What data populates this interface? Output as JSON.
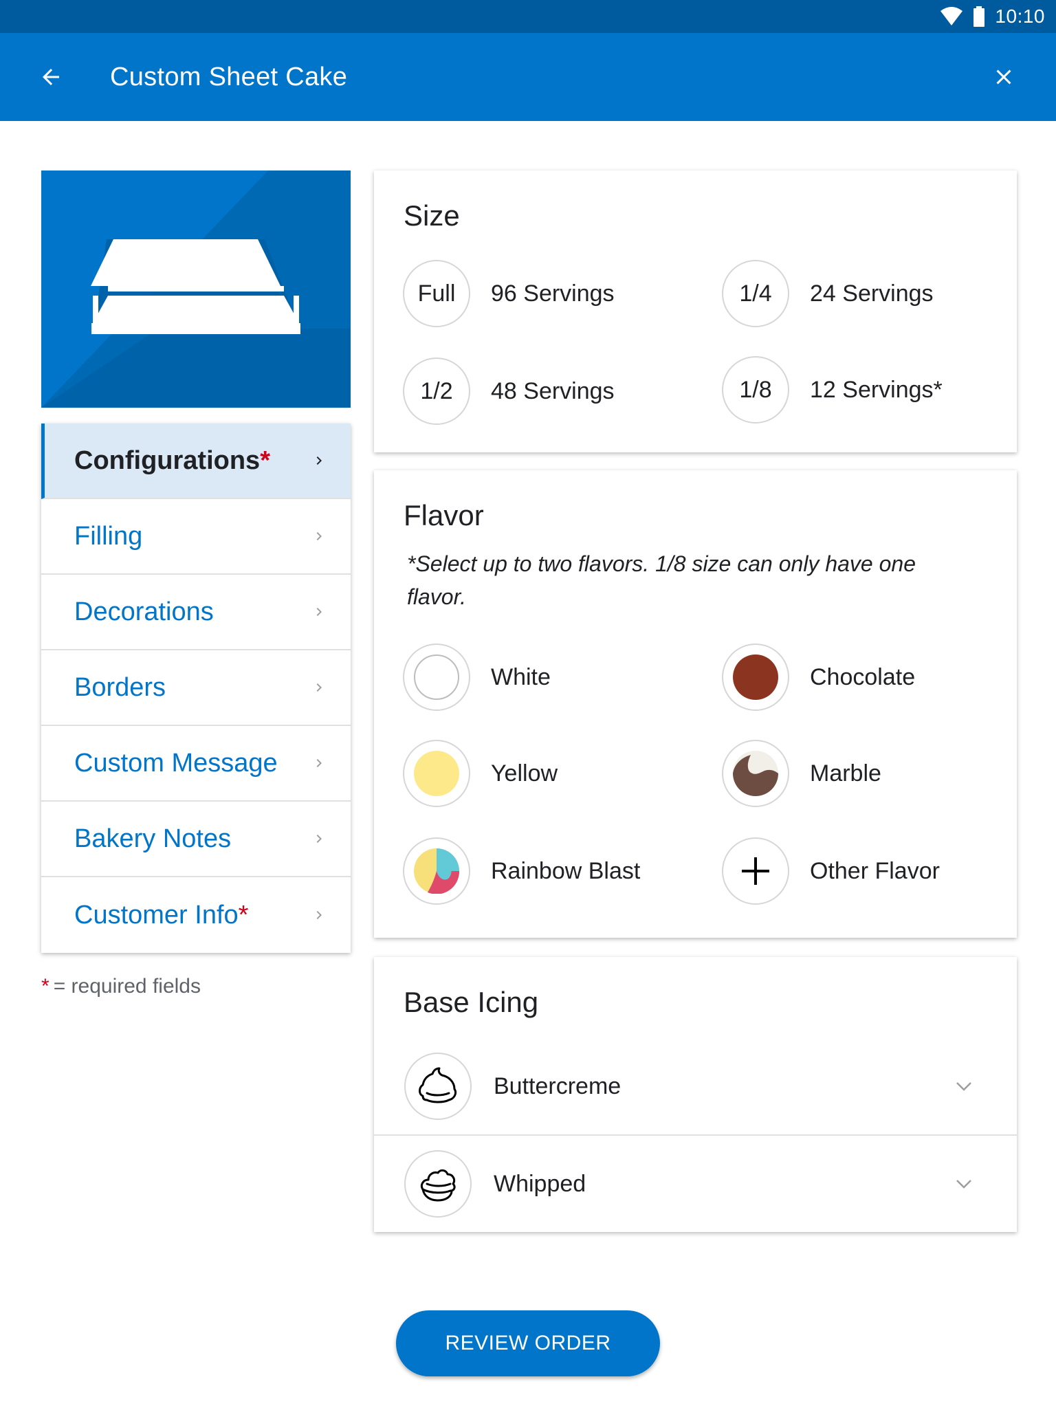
{
  "status_bar": {
    "time": "10:10"
  },
  "app_bar": {
    "title": "Custom Sheet Cake"
  },
  "side_nav": {
    "items": [
      {
        "label": "Configurations",
        "required": "*"
      },
      {
        "label": "Filling",
        "required": ""
      },
      {
        "label": "Decorations",
        "required": ""
      },
      {
        "label": "Borders",
        "required": ""
      },
      {
        "label": "Custom Message",
        "required": ""
      },
      {
        "label": "Bakery Notes",
        "required": ""
      },
      {
        "label": "Customer Info",
        "required": "*"
      }
    ],
    "required_note_star": "*",
    "required_note": "= required fields"
  },
  "size": {
    "title": "Size",
    "options": [
      {
        "badge": "Full",
        "label": "96 Servings"
      },
      {
        "badge": "1/4",
        "label": "24 Servings"
      },
      {
        "badge": "1/2",
        "label": "48 Servings"
      },
      {
        "badge": "1/8",
        "label": "12 Servings*"
      }
    ]
  },
  "flavor": {
    "title": "Flavor",
    "note": "*Select up to two flavors. 1/8 size can only have one flavor.",
    "options": [
      {
        "label": "White",
        "icon": "white-swatch-icon",
        "color": "#ffffff"
      },
      {
        "label": "Chocolate",
        "icon": "chocolate-swatch-icon",
        "color": "#8b3520"
      },
      {
        "label": "Yellow",
        "icon": "yellow-swatch-icon",
        "color": "#fde98a"
      },
      {
        "label": "Marble",
        "icon": "marble-swatch-icon",
        "color": "#6d4c41"
      },
      {
        "label": "Rainbow Blast",
        "icon": "rainbow-swatch-icon",
        "color": "#f7e07a"
      },
      {
        "label": "Other Flavor",
        "icon": "plus-icon",
        "color": "#000000"
      }
    ]
  },
  "icing": {
    "title": "Base Icing",
    "options": [
      {
        "label": "Buttercreme",
        "icon": "buttercreme-icon"
      },
      {
        "label": "Whipped",
        "icon": "whipped-icon"
      }
    ]
  },
  "review_button": {
    "label": "REVIEW ORDER"
  },
  "colors": {
    "primary": "#0075c9",
    "status_bar": "#005a9e",
    "required": "#d0021b",
    "nav_active_bg": "#dbe9f7"
  }
}
